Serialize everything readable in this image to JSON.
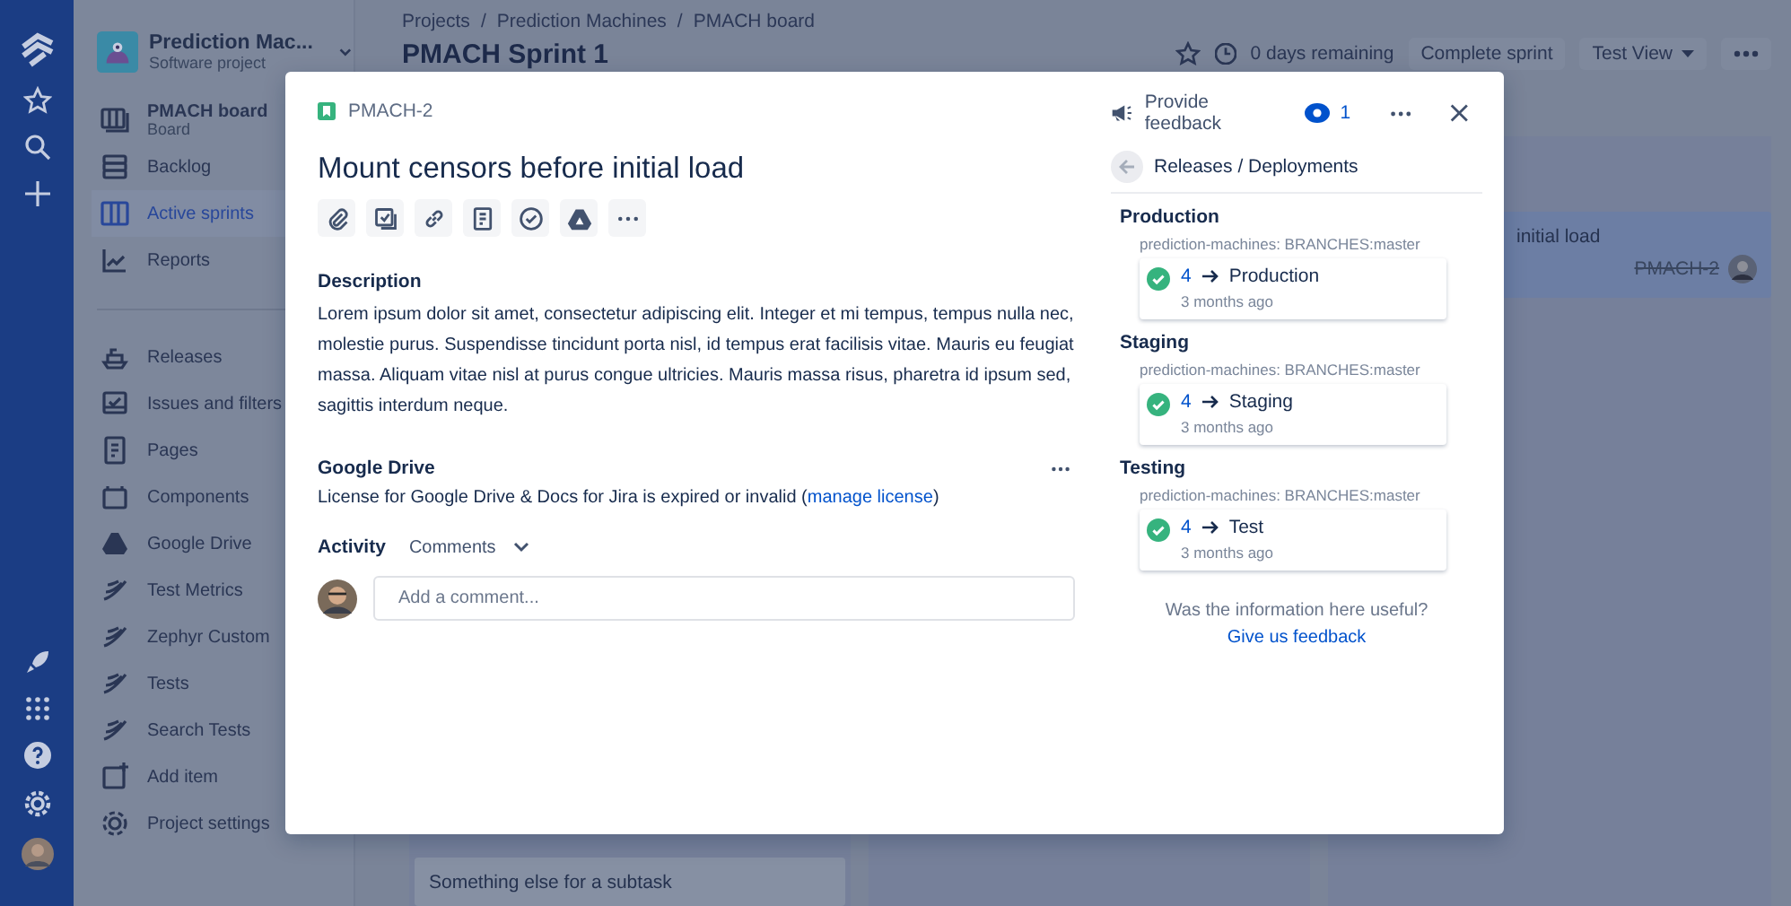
{
  "project": {
    "name": "Prediction Mac...",
    "type": "Software project"
  },
  "sidebar": {
    "primary": [
      {
        "label": "PMACH board",
        "sublabel": "Board",
        "selected": false
      },
      {
        "label": "Backlog",
        "selected": false
      },
      {
        "label": "Active sprints",
        "selected": true
      },
      {
        "label": "Reports",
        "selected": false
      }
    ],
    "secondary": [
      {
        "label": "Releases",
        "selected": false
      },
      {
        "label": "Issues and filters",
        "selected": false
      },
      {
        "label": "Pages",
        "selected": false
      },
      {
        "label": "Components",
        "selected": false
      },
      {
        "label": "Google Drive",
        "selected": false
      },
      {
        "label": "Test Metrics",
        "selected": false
      },
      {
        "label": "Zephyr Custom",
        "selected": false
      },
      {
        "label": "Tests",
        "selected": false
      },
      {
        "label": "Search Tests",
        "selected": false
      },
      {
        "label": "Add item",
        "selected": false
      },
      {
        "label": "Project settings",
        "selected": false
      }
    ]
  },
  "breadcrumbs": [
    "Projects",
    "Prediction Machines",
    "PMACH board"
  ],
  "breadcrumb_separator": "/",
  "board_title": "PMACH Sprint 1",
  "header_actions": {
    "remaining": "0 days remaining",
    "complete": "Complete sprint",
    "view": "Test View"
  },
  "board_cards": [
    {
      "title": "initial load",
      "key": "PMACH-2",
      "done": true
    },
    {
      "title": "Something else for a subtask"
    }
  ],
  "issue": {
    "key": "PMACH-2",
    "feedback": "Provide feedback",
    "watchers": "1",
    "title": "Mount censors before initial load",
    "description_heading": "Description",
    "description": "Lorem ipsum dolor sit amet, consectetur adipiscing elit. Integer et mi tempus, tempus nulla nec, molestie purus. Suspendisse tincidunt porta nisl, id tempus erat facilisis vitae. Mauris eu feugiat massa. Aliquam vitae nisl at purus congue ultricies. Mauris massa risus, pharetra id ipsum sed, sagittis interdum neque.",
    "drive_heading": "Google Drive",
    "license_prefix": "License for Google Drive & Docs for Jira is expired or invalid (",
    "license_link": "manage license",
    "license_suffix": ")",
    "activity": "Activity",
    "activity_filter": "Comments",
    "comment_placeholder": "Add a comment..."
  },
  "releases": {
    "title": "Releases / Deployments",
    "environments": [
      {
        "name": "Production",
        "branch": "prediction-machines: BRANCHES:master",
        "build": "4",
        "target": "Production",
        "time": "3 months ago"
      },
      {
        "name": "Staging",
        "branch": "prediction-machines: BRANCHES:master",
        "build": "4",
        "target": "Staging",
        "time": "3 months ago"
      },
      {
        "name": "Testing",
        "branch": "prediction-machines: BRANCHES:master",
        "build": "4",
        "target": "Test",
        "time": "3 months ago"
      }
    ],
    "question": "Was the information here useful?",
    "link": "Give us feedback"
  }
}
